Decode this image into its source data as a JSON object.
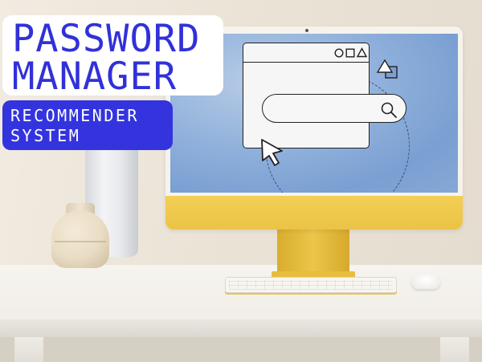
{
  "title": {
    "line1": "PASSWORD",
    "line2": "MANAGER"
  },
  "subtitle": {
    "line1": "RECOMMENDER",
    "line2": "SYSTEM"
  },
  "colors": {
    "title_text": "#3131d9",
    "subtitle_bg": "#3434df",
    "imac_accent": "#ebc346",
    "screen_blue": "#8fb0db"
  },
  "icons": {
    "browser_controls": [
      "circle-icon",
      "square-icon",
      "triangle-icon"
    ],
    "search": "search-icon",
    "pointer": "cursor-icon",
    "shapes": "shapes-icon"
  }
}
